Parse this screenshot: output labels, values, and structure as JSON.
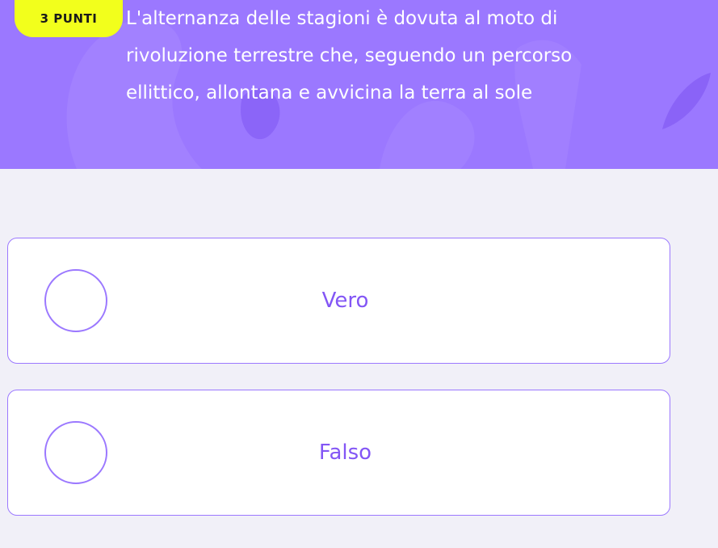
{
  "header": {
    "points_badge": "3 PUNTI",
    "question_lines": [
      "L'alternanza delle stagioni è dovuta al moto di",
      "rivoluzione terrestre che, seguendo un percorso",
      "ellittico, allontana e avvicina la terra al sole"
    ]
  },
  "options": [
    {
      "label": "Vero"
    },
    {
      "label": "Falso"
    }
  ],
  "colors": {
    "header_bg": "#9b78ff",
    "badge_bg": "#f2ff1c",
    "accent": "#9b78ff",
    "option_text": "#8356f5",
    "page_bg": "#f1f0f8"
  }
}
